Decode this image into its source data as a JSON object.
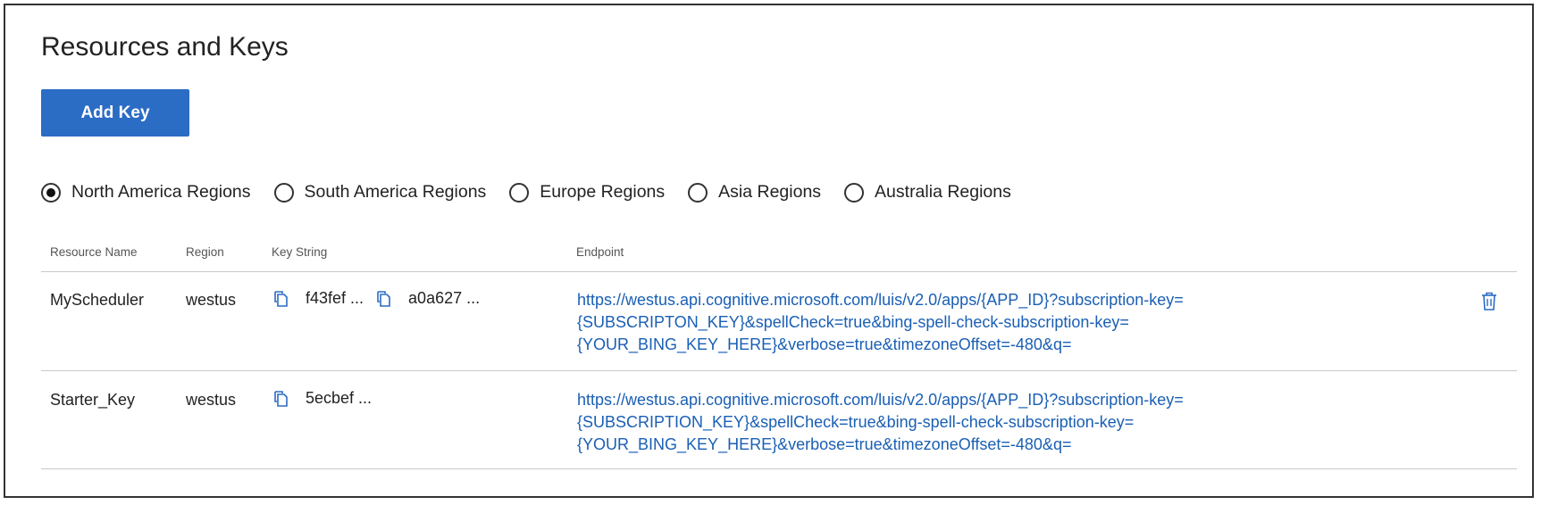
{
  "header": {
    "title": "Resources and Keys"
  },
  "toolbar": {
    "add_key_label": "Add Key"
  },
  "regions": [
    {
      "label": "North America Regions",
      "selected": true
    },
    {
      "label": "South America Regions",
      "selected": false
    },
    {
      "label": "Europe Regions",
      "selected": false
    },
    {
      "label": "Asia Regions",
      "selected": false
    },
    {
      "label": "Australia Regions",
      "selected": false
    }
  ],
  "table": {
    "columns": [
      "Resource Name",
      "Region",
      "Key String",
      "Endpoint"
    ],
    "rows": [
      {
        "name": "MyScheduler",
        "region": "westus",
        "keys": [
          "f43fef ...",
          "a0a627 ..."
        ],
        "endpoint_lines": [
          "https://westus.api.cognitive.microsoft.com/luis/v2.0/apps/{APP_ID}?subscription-key=",
          "{SUBSCRIPTON_KEY}&spellCheck=true&bing-spell-check-subscription-key=",
          "{YOUR_BING_KEY_HERE}&verbose=true&timezoneOffset=-480&q="
        ]
      },
      {
        "name": "Starter_Key",
        "region": "westus",
        "keys": [
          "5ecbef ..."
        ],
        "endpoint_lines": [
          "https://westus.api.cognitive.microsoft.com/luis/v2.0/apps/{APP_ID}?subscription-key=",
          "{SUBSCRIPTION_KEY}&spellCheck=true&bing-spell-check-subscription-key=",
          "{YOUR_BING_KEY_HERE}&verbose=true&timezoneOffset=-480&q="
        ]
      }
    ]
  },
  "colors": {
    "accent": "#2b6cc4",
    "link": "#1a5fb4"
  },
  "icons": {
    "copy": "copy-icon",
    "delete": "trash-icon"
  }
}
